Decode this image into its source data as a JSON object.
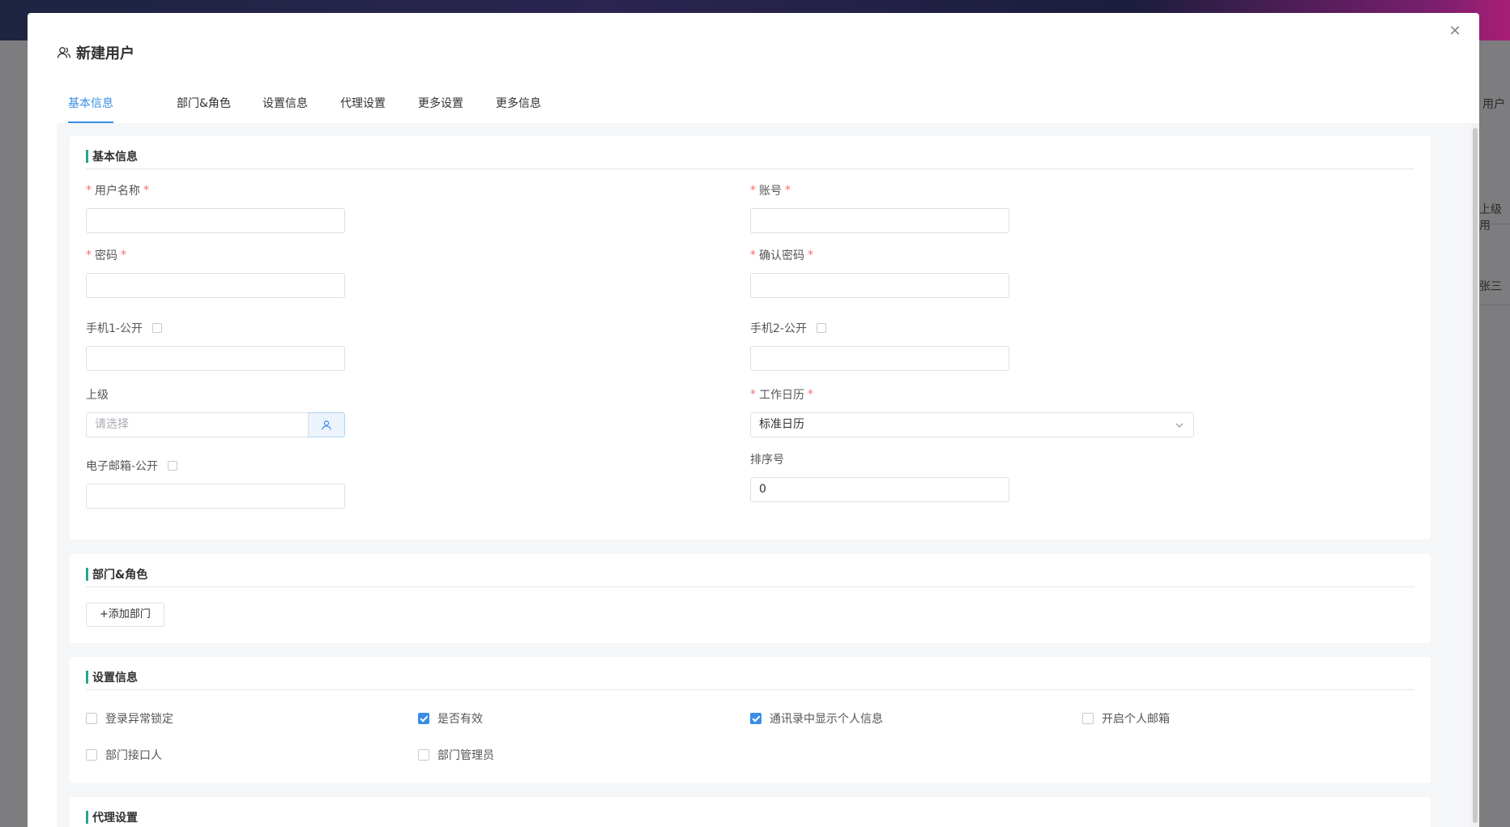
{
  "background": {
    "right_labels": [
      "用户",
      "上级用",
      "张三"
    ]
  },
  "modal": {
    "title": "新建用户",
    "close_icon": "close-icon",
    "tabs": [
      {
        "label": "基本信息",
        "active": true
      },
      {
        "label": "部门&角色",
        "active": false
      },
      {
        "label": "设置信息",
        "active": false
      },
      {
        "label": "代理设置",
        "active": false
      },
      {
        "label": "更多设置",
        "active": false
      },
      {
        "label": "更多信息",
        "active": false
      }
    ]
  },
  "basic_info": {
    "section_title": "基本信息",
    "required_mark": "*",
    "username": {
      "label": "用户名称",
      "value": ""
    },
    "account": {
      "label": "账号",
      "value": ""
    },
    "password": {
      "label": "密码",
      "value": ""
    },
    "confirm_password": {
      "label": "确认密码",
      "value": ""
    },
    "phone1": {
      "label": "手机1-公开",
      "public": false,
      "value": ""
    },
    "phone2": {
      "label": "手机2-公开",
      "public": false,
      "value": ""
    },
    "superior": {
      "label": "上级",
      "placeholder": "请选择",
      "value": ""
    },
    "work_calendar": {
      "label": "工作日历",
      "value": "标准日历"
    },
    "email": {
      "label": "电子邮箱-公开",
      "public": false,
      "value": ""
    },
    "sort_no": {
      "label": "排序号",
      "value": "0"
    }
  },
  "dept_role": {
    "section_title": "部门&角色",
    "add_button": "+添加部门"
  },
  "settings": {
    "section_title": "设置信息",
    "options": [
      {
        "label": "登录异常锁定",
        "checked": false
      },
      {
        "label": "是否有效",
        "checked": true
      },
      {
        "label": "通讯录中显示个人信息",
        "checked": true
      },
      {
        "label": "开启个人邮箱",
        "checked": false
      },
      {
        "label": "部门接口人",
        "checked": false
      },
      {
        "label": "部门管理员",
        "checked": false
      }
    ]
  },
  "proxy": {
    "section_title": "代理设置"
  },
  "colors": {
    "accent": "#3a8ee6",
    "section_bar": "#27a58f",
    "required": "#f56c6c"
  }
}
